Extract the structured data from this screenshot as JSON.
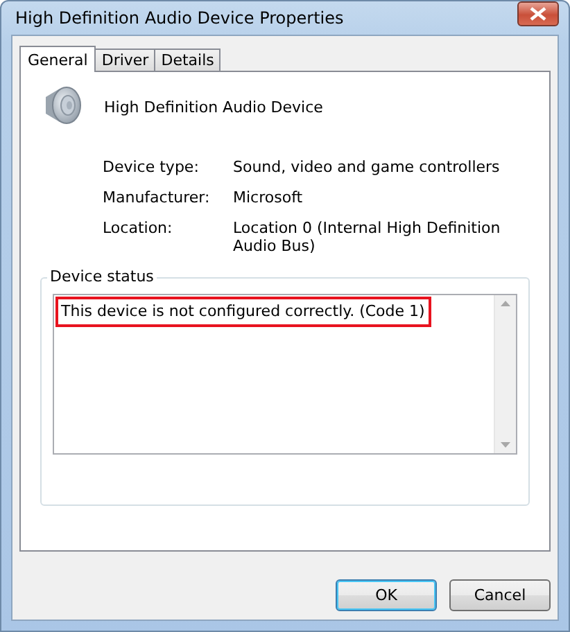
{
  "window": {
    "title": "High Definition Audio Device Properties"
  },
  "tabs": [
    {
      "label": "General",
      "selected": true
    },
    {
      "label": "Driver",
      "selected": false
    },
    {
      "label": "Details",
      "selected": false
    }
  ],
  "device": {
    "name": "High Definition Audio Device"
  },
  "properties": [
    {
      "label": "Device type:",
      "value": "Sound, video and game controllers"
    },
    {
      "label": "Manufacturer:",
      "value": "Microsoft"
    },
    {
      "label": "Location:",
      "value": "Location 0 (Internal High Definition Audio Bus)"
    }
  ],
  "device_status": {
    "title": "Device status",
    "text": "This device is not configured correctly. (Code 1)",
    "highlighted": true
  },
  "buttons": [
    {
      "label": "OK",
      "default": true
    },
    {
      "label": "Cancel",
      "default": false
    }
  ]
}
